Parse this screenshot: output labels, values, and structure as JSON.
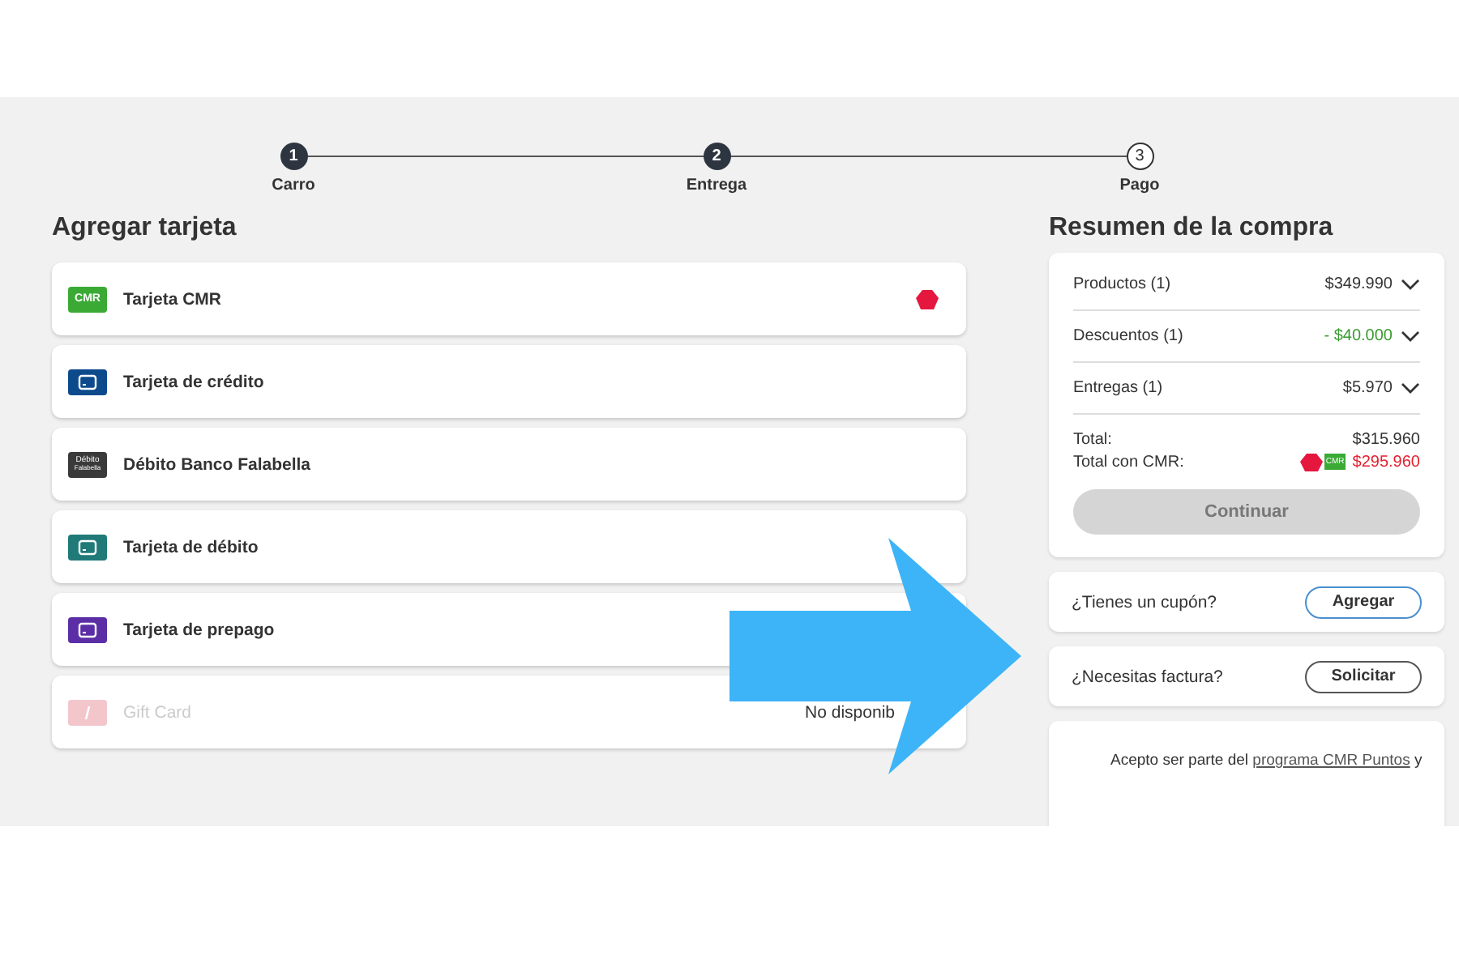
{
  "steps": [
    {
      "number": "1",
      "label": "Carro",
      "completed": true
    },
    {
      "number": "2",
      "label": "Entrega",
      "completed": true
    },
    {
      "number": "3",
      "label": "Pago",
      "completed": false
    }
  ],
  "payment": {
    "title": "Agregar tarjeta",
    "methods": [
      {
        "kind": "cmr",
        "label": "Tarjeta CMR",
        "icon_text": "CMR",
        "color": "#3aaa35",
        "disabled": false
      },
      {
        "kind": "card",
        "label": "Tarjeta de crédito",
        "color": "#0d4a8c",
        "disabled": false
      },
      {
        "kind": "falabella",
        "label": "Débito Banco Falabella",
        "icon_text": "Débito",
        "icon_subtext": "Falabella",
        "color": "#3a3a3a",
        "disabled": false
      },
      {
        "kind": "card",
        "label": "Tarjeta de débito",
        "color": "#1f7a78",
        "disabled": false
      },
      {
        "kind": "card",
        "label": "Tarjeta de prepago",
        "color": "#5b2ea6",
        "disabled": false
      },
      {
        "kind": "gift",
        "label": "Gift Card",
        "color": "#f3c6cc",
        "disabled": true,
        "status": "No disponib"
      }
    ]
  },
  "summary": {
    "title": "Resumen de la compra",
    "rows": [
      {
        "label": "Productos (1)",
        "amount": "$349.990",
        "kind": "normal"
      },
      {
        "label": "Descuentos (1)",
        "amount": "- $40.000",
        "kind": "discount"
      },
      {
        "label": "Entregas (1)",
        "amount": "$5.970",
        "kind": "normal"
      }
    ],
    "total_label": "Total:",
    "total": "$315.960",
    "cmr_label": "Total con CMR:",
    "cmr_badge": "CMR",
    "cmr_total": "$295.960",
    "button": {
      "label": "Continuar",
      "disabled": true
    }
  },
  "coupon": {
    "question": "¿Tienes un cupón?",
    "button": "Agregar"
  },
  "invoice": {
    "question": "¿Necesitas factura?",
    "button": "Solicitar"
  },
  "consent": {
    "before": "Acepto ser parte del",
    "link": "programa CMR Puntos",
    "after": "y"
  }
}
